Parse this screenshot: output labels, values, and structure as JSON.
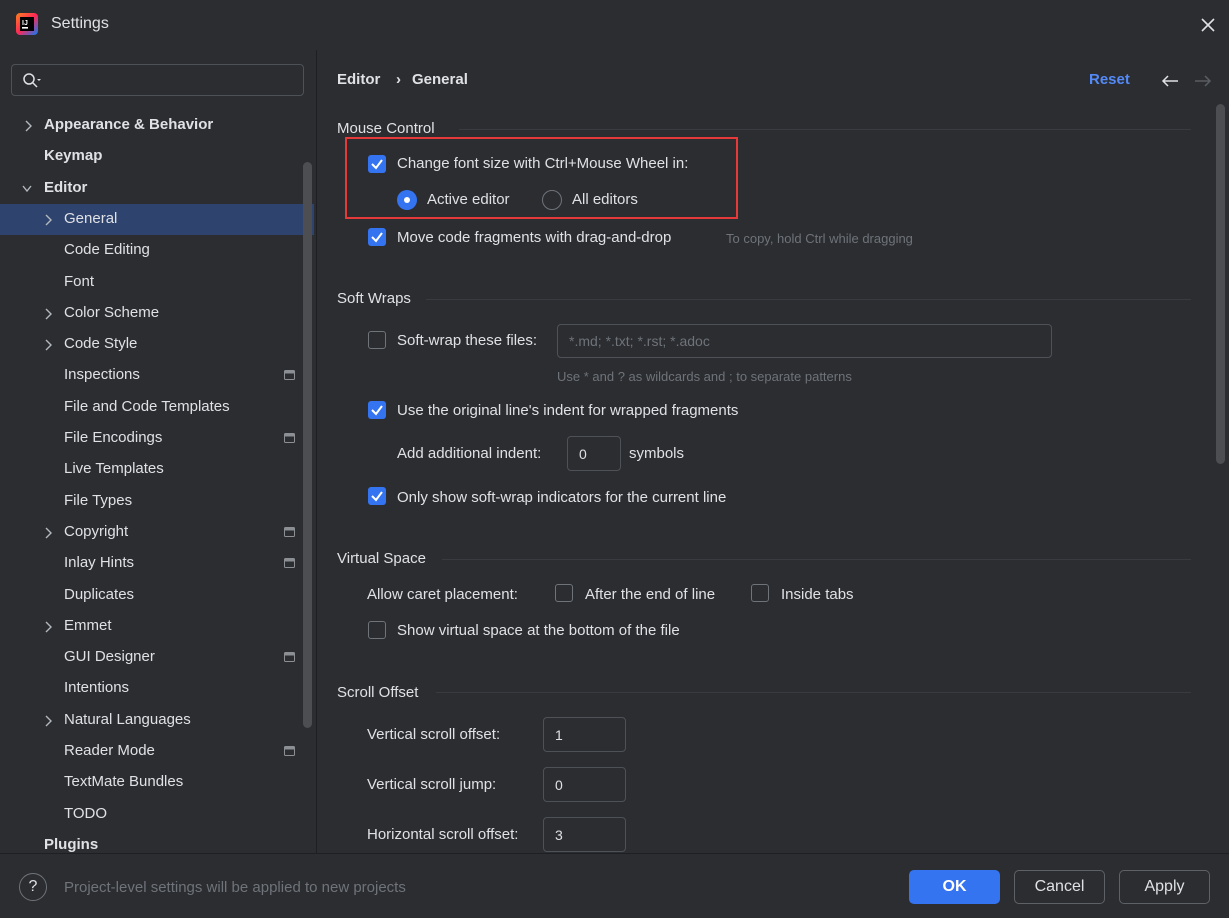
{
  "window": {
    "title": "Settings"
  },
  "search": {
    "placeholder": ""
  },
  "sidebar": {
    "items": [
      {
        "label": "Appearance & Behavior",
        "level": 0,
        "bold": true,
        "chevron": "right",
        "project_icon": false
      },
      {
        "label": "Keymap",
        "level": 0,
        "bold": true,
        "chevron": "none",
        "project_icon": false
      },
      {
        "label": "Editor",
        "level": 0,
        "bold": true,
        "chevron": "down",
        "project_icon": false
      },
      {
        "label": "General",
        "level": 1,
        "bold": false,
        "chevron": "right",
        "project_icon": false,
        "selected": true
      },
      {
        "label": "Code Editing",
        "level": 1,
        "bold": false,
        "chevron": "none",
        "project_icon": false
      },
      {
        "label": "Font",
        "level": 1,
        "bold": false,
        "chevron": "none",
        "project_icon": false
      },
      {
        "label": "Color Scheme",
        "level": 1,
        "bold": false,
        "chevron": "right",
        "project_icon": false
      },
      {
        "label": "Code Style",
        "level": 1,
        "bold": false,
        "chevron": "right",
        "project_icon": false
      },
      {
        "label": "Inspections",
        "level": 1,
        "bold": false,
        "chevron": "none",
        "project_icon": true
      },
      {
        "label": "File and Code Templates",
        "level": 1,
        "bold": false,
        "chevron": "none",
        "project_icon": false
      },
      {
        "label": "File Encodings",
        "level": 1,
        "bold": false,
        "chevron": "none",
        "project_icon": true
      },
      {
        "label": "Live Templates",
        "level": 1,
        "bold": false,
        "chevron": "none",
        "project_icon": false
      },
      {
        "label": "File Types",
        "level": 1,
        "bold": false,
        "chevron": "none",
        "project_icon": false
      },
      {
        "label": "Copyright",
        "level": 1,
        "bold": false,
        "chevron": "right",
        "project_icon": true
      },
      {
        "label": "Inlay Hints",
        "level": 1,
        "bold": false,
        "chevron": "none",
        "project_icon": true
      },
      {
        "label": "Duplicates",
        "level": 1,
        "bold": false,
        "chevron": "none",
        "project_icon": false
      },
      {
        "label": "Emmet",
        "level": 1,
        "bold": false,
        "chevron": "right",
        "project_icon": false
      },
      {
        "label": "GUI Designer",
        "level": 1,
        "bold": false,
        "chevron": "none",
        "project_icon": true
      },
      {
        "label": "Intentions",
        "level": 1,
        "bold": false,
        "chevron": "none",
        "project_icon": false
      },
      {
        "label": "Natural Languages",
        "level": 1,
        "bold": false,
        "chevron": "right",
        "project_icon": false
      },
      {
        "label": "Reader Mode",
        "level": 1,
        "bold": false,
        "chevron": "none",
        "project_icon": true
      },
      {
        "label": "TextMate Bundles",
        "level": 1,
        "bold": false,
        "chevron": "none",
        "project_icon": false
      },
      {
        "label": "TODO",
        "level": 1,
        "bold": false,
        "chevron": "none",
        "project_icon": false
      },
      {
        "label": "Plugins",
        "level": 0,
        "bold": true,
        "chevron": "none",
        "project_icon": false
      }
    ]
  },
  "breadcrumb": {
    "parent": "Editor",
    "separator": "›",
    "current": "General"
  },
  "header": {
    "reset_label": "Reset"
  },
  "mouse_control": {
    "title": "Mouse Control",
    "change_font_size": {
      "label": "Change font size with Ctrl+Mouse Wheel in:",
      "checked": true
    },
    "active_editor": {
      "label": "Active editor",
      "selected": true
    },
    "all_editors": {
      "label": "All editors",
      "selected": false
    },
    "drag_drop": {
      "label": "Move code fragments with drag-and-drop",
      "checked": true,
      "hint": "To copy, hold Ctrl while dragging"
    }
  },
  "soft_wraps": {
    "title": "Soft Wraps",
    "soft_wrap_files": {
      "label": "Soft-wrap these files:",
      "checked": false,
      "placeholder": "*.md; *.txt; *.rst; *.adoc",
      "hint": "Use * and ? as wildcards and ; to separate patterns"
    },
    "original_indent": {
      "label": "Use the original line's indent for wrapped fragments",
      "checked": true
    },
    "additional_indent": {
      "label": "Add additional indent:",
      "value": "0",
      "suffix": "symbols"
    },
    "indicators": {
      "label": "Only show soft-wrap indicators for the current line",
      "checked": true
    }
  },
  "virtual_space": {
    "title": "Virtual Space",
    "caret_label": "Allow caret placement:",
    "after_end": {
      "label": "After the end of line",
      "checked": false
    },
    "inside_tabs": {
      "label": "Inside tabs",
      "checked": false
    },
    "bottom": {
      "label": "Show virtual space at the bottom of the file",
      "checked": false
    }
  },
  "scroll_offset": {
    "title": "Scroll Offset",
    "vertical_offset": {
      "label": "Vertical scroll offset:",
      "value": "1"
    },
    "vertical_jump": {
      "label": "Vertical scroll jump:",
      "value": "0"
    },
    "horizontal_offset": {
      "label": "Horizontal scroll offset:",
      "value": "3"
    }
  },
  "footer": {
    "help_label": "?",
    "note": "Project-level settings will be applied to new projects",
    "ok_label": "OK",
    "cancel_label": "Cancel",
    "apply_label": "Apply"
  },
  "colors": {
    "accent": "#3574f0",
    "link": "#548af7",
    "highlight_box": "#e5393a",
    "selection": "#2e436e"
  }
}
